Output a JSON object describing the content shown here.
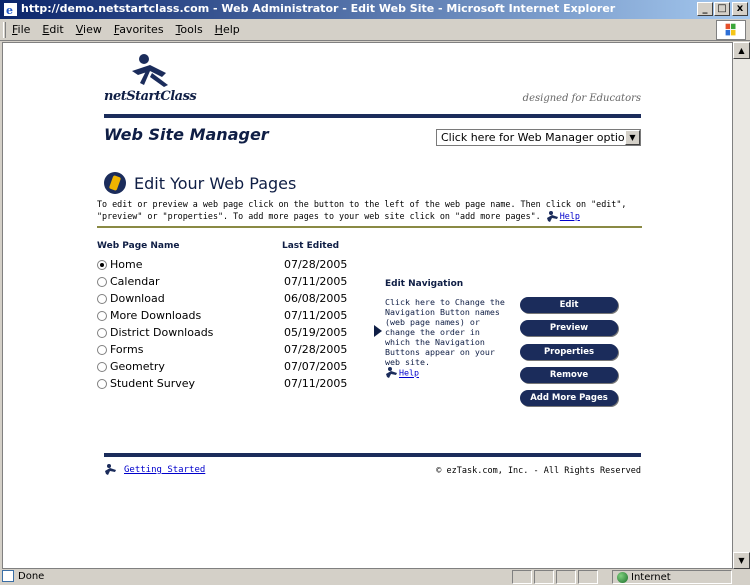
{
  "window": {
    "title": "http://demo.netstartclass.com - Web Administrator - Edit Web Site - Microsoft Internet Explorer",
    "min_label": "_",
    "max_label": "□",
    "close_label": "x"
  },
  "menu": {
    "items": [
      "File",
      "Edit",
      "View",
      "Favorites",
      "Tools",
      "Help"
    ]
  },
  "header": {
    "logo": "netStartClass",
    "tagline": "designed for Educators",
    "section_title": "Web Site Manager",
    "options_value": "Click here for Web Manager options!"
  },
  "main": {
    "title": "Edit Your Web Pages",
    "intro": "To edit or preview a web page click on the button to the left of the web page name.  Then click on \"edit\", \"preview\" or \"properties\".  To add more pages to your web site click on \"add more pages\".",
    "help_label": "Help",
    "col_name": "Web Page Name",
    "col_date": "Last Edited",
    "pages": [
      {
        "name": "Home",
        "date": "07/28/2005"
      },
      {
        "name": "Calendar",
        "date": "07/11/2005"
      },
      {
        "name": "Download",
        "date": "06/08/2005"
      },
      {
        "name": "More Downloads",
        "date": "07/11/2005"
      },
      {
        "name": "District Downloads",
        "date": "05/19/2005"
      },
      {
        "name": "Forms",
        "date": "07/28/2005"
      },
      {
        "name": "Geometry",
        "date": "07/07/2005"
      },
      {
        "name": "Student Survey",
        "date": "07/11/2005"
      }
    ],
    "selected_index": 0
  },
  "edit_nav": {
    "heading": "Edit Navigation",
    "body": "Click here to Change the Navigation Button names (web page names) or change the order in which the Navigation Buttons appear on your web site.",
    "help_label": "Help"
  },
  "actions": {
    "edit": "Edit",
    "preview": "Preview",
    "properties": "Properties",
    "remove": "Remove",
    "add": "Add More Pages"
  },
  "footer": {
    "getting_started": "Getting Started",
    "copyright": "© ezTask.com, Inc. - All Rights Reserved"
  },
  "status": {
    "text": "Done",
    "zone": "Internet"
  }
}
